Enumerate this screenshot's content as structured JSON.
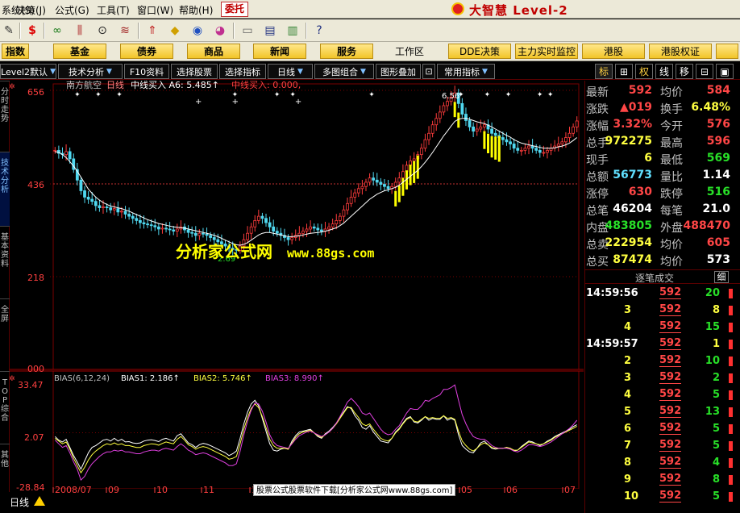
{
  "menu": {
    "items": [
      "系统(S)",
      "决策(J)",
      "公式(G)",
      "工具(T)",
      "窗口(W)",
      "帮助(H)"
    ],
    "weituo": "委托"
  },
  "brand": {
    "name": "大智慧 Level-2"
  },
  "category_buttons": [
    "指数",
    "基金",
    "债券",
    "商品",
    "新闻",
    "服务",
    "DDE决策",
    "主力实时监控",
    "港股",
    "港股权证"
  ],
  "workarea_label": "工作区",
  "func_tabs": [
    "Level2默认",
    "技术分析",
    "F10资料",
    "选择股票",
    "选择指标",
    "日线",
    "多图组合",
    "图形叠加",
    "常用指标"
  ],
  "right_tabs": [
    "标",
    "⊞",
    "权",
    "线",
    "移",
    "⊟",
    "▣"
  ],
  "left_tabs": [
    "分时走势",
    "技术分析",
    "基本资料",
    "全屏",
    "TOP综合",
    "其他"
  ],
  "chart": {
    "stock_name": "南方航空",
    "period_label": "日线",
    "indicator_line": "中线买入  A6: 5.485↑",
    "indicator_line2": "中线买入: 0.000,",
    "price_axis": [
      "656",
      "436",
      "218",
      "000"
    ],
    "hi_label": "6.56",
    "lo_label": "2.69",
    "bias_header": "BIAS(6,12,24)",
    "bias1_label": "BIAS1: 2.186↑",
    "bias2_label": "BIAS2: 5.746↑",
    "bias3_label": "BIAS3: 8.990↑",
    "bias_axis": [
      "33.47",
      "2.07",
      "-28.84"
    ],
    "date_axis": [
      "2008/07",
      "09",
      "10",
      "11",
      "12",
      "2009/02",
      "03",
      "04",
      "05",
      "06",
      "07"
    ],
    "colors": {
      "up": "#ff3c3c",
      "down": "#50d8f0",
      "ma": "#ffffff",
      "signal": "#ffff00",
      "bias1": "#ffffff",
      "bias2": "#ffff40",
      "bias3": "#e040e0",
      "grid": "#7a0000"
    }
  },
  "chart_data": {
    "type": "candlestick",
    "x_range": [
      "2008/07",
      "2009/07"
    ],
    "ylim": [
      0,
      6.56
    ],
    "close": [
      5.15,
      5.08,
      5.05,
      5.12,
      4.95,
      4.7,
      4.45,
      4.2,
      4.05,
      4.0,
      3.95,
      3.85,
      3.8,
      3.82,
      3.8,
      3.75,
      3.78,
      3.7,
      3.72,
      3.65,
      3.6,
      3.55,
      3.5,
      3.45,
      3.42,
      3.4,
      3.38,
      3.35,
      3.3,
      3.32,
      3.3,
      3.28,
      3.25,
      3.3,
      3.35,
      3.28,
      3.22,
      3.2,
      3.15,
      3.2,
      3.18,
      3.15,
      3.1,
      3.05,
      3.0,
      2.95,
      2.9,
      2.85,
      2.82,
      2.8,
      2.9,
      3.05,
      3.2,
      3.35,
      3.5,
      3.6,
      3.55,
      3.45,
      3.35,
      3.25,
      3.2,
      3.15,
      3.1,
      3.05,
      3.1,
      3.15,
      3.2,
      3.25,
      3.3,
      3.35,
      3.32,
      3.28,
      3.25,
      3.3,
      3.35,
      3.42,
      3.5,
      3.6,
      3.75,
      3.9,
      4.05,
      4.15,
      4.25,
      4.3,
      4.4,
      4.5,
      4.45,
      4.4,
      4.35,
      4.3,
      4.25,
      4.3,
      4.4,
      4.5,
      4.65,
      4.8,
      4.9,
      4.95,
      5.05,
      5.2,
      5.4,
      5.55,
      5.75,
      5.9,
      6.05,
      6.2,
      6.3,
      6.4,
      6.5,
      6.25,
      6.0,
      5.85,
      5.7,
      5.6,
      5.65,
      5.7,
      5.75,
      5.65,
      5.55,
      5.5,
      5.45,
      5.4,
      5.35,
      5.3,
      5.2,
      5.15,
      5.15,
      5.2,
      5.25,
      5.2,
      5.15,
      5.1,
      5.1,
      5.15,
      5.2,
      5.25,
      5.3,
      5.35,
      5.45,
      5.55,
      5.7,
      5.84
    ],
    "ma": [
      5.12,
      5.1,
      5.05,
      4.98,
      4.88,
      4.78,
      4.66,
      4.52,
      4.38,
      4.24,
      4.14,
      4.05,
      3.98,
      3.92,
      3.88,
      3.84,
      3.82,
      3.8,
      3.78,
      3.75,
      3.72,
      3.68,
      3.64,
      3.6,
      3.56,
      3.52,
      3.49,
      3.46,
      3.43,
      3.41,
      3.39,
      3.37,
      3.35,
      3.34,
      3.33,
      3.32,
      3.3,
      3.28,
      3.26,
      3.24,
      3.22,
      3.2,
      3.18,
      3.15,
      3.12,
      3.08,
      3.04,
      3.0,
      2.96,
      2.93,
      2.92,
      2.94,
      2.98,
      3.04,
      3.1,
      3.16,
      3.2,
      3.22,
      3.22,
      3.2,
      3.18,
      3.16,
      3.14,
      3.12,
      3.12,
      3.13,
      3.14,
      3.16,
      3.18,
      3.2,
      3.21,
      3.22,
      3.23,
      3.25,
      3.27,
      3.3,
      3.33,
      3.38,
      3.44,
      3.52,
      3.6,
      3.68,
      3.76,
      3.84,
      3.92,
      4.0,
      4.06,
      4.12,
      4.16,
      4.2,
      4.22,
      4.25,
      4.28,
      4.33,
      4.4,
      4.47,
      4.54,
      4.61,
      4.68,
      4.77,
      4.87,
      4.98,
      5.1,
      5.23,
      5.36,
      5.49,
      5.6,
      5.72,
      5.83,
      5.88,
      5.9,
      5.9,
      5.88,
      5.85,
      5.82,
      5.8,
      5.78,
      5.74,
      5.7,
      5.65,
      5.6,
      5.55,
      5.5,
      5.46,
      5.4,
      5.36,
      5.32,
      5.3,
      5.28,
      5.26,
      5.24,
      5.22,
      5.2,
      5.2,
      5.2,
      5.21,
      5.23,
      5.25,
      5.28,
      5.32,
      5.38,
      5.45
    ],
    "signals": [
      {
        "i": 92,
        "level": 0.42
      },
      {
        "i": 93,
        "level": 0.48
      },
      {
        "i": 94,
        "level": 0.55
      },
      {
        "i": 95,
        "level": 0.62
      },
      {
        "i": 96,
        "level": 0.7
      },
      {
        "i": 97,
        "level": 0.78
      },
      {
        "i": 98,
        "level": 0.86
      },
      {
        "i": 108,
        "level": 0.4
      },
      {
        "i": 109,
        "level": 0.4
      },
      {
        "i": 116,
        "level": 0.55
      },
      {
        "i": 117,
        "level": 0.65
      },
      {
        "i": 118,
        "level": 0.75
      },
      {
        "i": 119,
        "level": 0.85
      },
      {
        "i": 120,
        "level": 1.0
      }
    ],
    "bias_ylim": [
      -28.84,
      33.47
    ],
    "bias1": [
      0.0,
      -2.0,
      -3.0,
      -1.5,
      -6.0,
      -10.5,
      -14.0,
      -18.0,
      -13.5,
      -9.0,
      -6.0,
      -5.0,
      -3.5,
      -2.0,
      -1.5,
      -2.5,
      -1.0,
      -2.5,
      -1.5,
      -3.0,
      -2.8,
      -3.5,
      -3.8,
      -3.5,
      -2.5,
      -2.0,
      -1.8,
      -2.2,
      -2.8,
      -1.5,
      -1.0,
      -1.8,
      -2.5,
      0.5,
      1.5,
      -1.0,
      -3.5,
      -4.5,
      -6.0,
      -4.5,
      -3.8,
      -4.2,
      -5.0,
      -6.0,
      -7.0,
      -8.0,
      -9.0,
      -10.5,
      -9.5,
      -8.0,
      -1.0,
      7.0,
      13.5,
      18.0,
      20.0,
      17.0,
      10.0,
      3.0,
      -4.0,
      -7.5,
      -8.0,
      -7.0,
      -6.5,
      -7.0,
      -2.5,
      0.5,
      2.5,
      3.0,
      3.5,
      4.0,
      2.0,
      0.0,
      -1.0,
      1.5,
      3.0,
      5.0,
      7.5,
      10.5,
      13.5,
      16.5,
      15.5,
      11.5,
      9.0,
      5.0,
      4.0,
      6.0,
      2.5,
      0.0,
      -2.5,
      -3.0,
      -3.5,
      -1.0,
      2.5,
      4.5,
      7.5,
      10.0,
      11.0,
      8.0,
      7.5,
      9.0,
      11.0,
      9.0,
      10.0,
      9.5,
      9.5,
      11.5,
      9.0,
      10.0,
      9.0,
      1.0,
      -5.0,
      -7.0,
      -8.5,
      -9.0,
      -6.5,
      -3.5,
      -2.5,
      -4.5,
      -6.5,
      -7.0,
      -6.5,
      -6.5,
      -6.0,
      -6.5,
      -8.0,
      -7.5,
      -5.5,
      -4.0,
      -2.5,
      -3.0,
      -4.0,
      -5.0,
      -4.0,
      -2.5,
      -1.5,
      0.0,
      1.0,
      2.0,
      3.0,
      4.0,
      5.5,
      6.5
    ],
    "bias2": [
      -1.0,
      -2.5,
      -4.0,
      -3.0,
      -7.0,
      -12.0,
      -16.0,
      -20.0,
      -17.0,
      -13.0,
      -10.0,
      -8.0,
      -6.5,
      -5.0,
      -4.0,
      -4.5,
      -3.5,
      -4.5,
      -4.0,
      -5.0,
      -5.0,
      -5.5,
      -6.0,
      -6.0,
      -5.0,
      -4.5,
      -4.0,
      -4.2,
      -4.8,
      -3.8,
      -3.0,
      -3.5,
      -4.0,
      -1.5,
      0.0,
      -2.0,
      -4.5,
      -5.5,
      -7.0,
      -6.0,
      -5.5,
      -6.0,
      -7.0,
      -8.0,
      -9.0,
      -10.0,
      -11.0,
      -12.5,
      -12.0,
      -11.0,
      -4.0,
      4.0,
      10.5,
      15.5,
      18.0,
      16.0,
      11.0,
      5.0,
      -1.5,
      -5.0,
      -6.5,
      -6.5,
      -6.5,
      -7.0,
      -3.5,
      -0.5,
      1.5,
      2.5,
      3.0,
      3.5,
      2.0,
      0.5,
      -0.5,
      1.0,
      2.5,
      4.5,
      7.0,
      10.0,
      13.0,
      16.0,
      16.0,
      13.0,
      10.5,
      7.0,
      6.0,
      7.0,
      4.0,
      1.5,
      -1.0,
      -2.0,
      -2.5,
      -1.0,
      2.0,
      4.0,
      7.0,
      9.5,
      10.5,
      8.5,
      8.0,
      9.5,
      11.0,
      10.0,
      10.5,
      10.0,
      10.0,
      11.5,
      10.0,
      10.5,
      9.5,
      3.0,
      -2.5,
      -5.0,
      -7.0,
      -8.0,
      -6.5,
      -4.5,
      -3.5,
      -4.5,
      -6.0,
      -6.5,
      -6.5,
      -6.5,
      -6.0,
      -6.5,
      -7.5,
      -7.5,
      -6.0,
      -4.5,
      -3.0,
      -3.5,
      -4.0,
      -4.5,
      -4.0,
      -3.0,
      -2.0,
      -0.5,
      0.5,
      1.5,
      2.5,
      3.5,
      4.5,
      5.7
    ],
    "bias3": [
      -2.0,
      -4.0,
      -6.0,
      -5.0,
      -9.0,
      -14.0,
      -18.0,
      -24.0,
      -22.0,
      -18.0,
      -15.0,
      -13.0,
      -11.0,
      -9.5,
      -8.5,
      -8.5,
      -7.5,
      -8.0,
      -7.5,
      -8.5,
      -8.5,
      -9.0,
      -9.5,
      -9.5,
      -8.5,
      -8.0,
      -7.5,
      -7.5,
      -8.0,
      -7.0,
      -6.5,
      -7.0,
      -7.5,
      -5.5,
      -4.0,
      -5.5,
      -7.5,
      -8.5,
      -10.0,
      -9.5,
      -9.0,
      -9.5,
      -10.5,
      -11.5,
      -12.5,
      -13.5,
      -14.5,
      -16.0,
      -16.0,
      -15.0,
      -8.0,
      1.0,
      8.5,
      14.5,
      18.5,
      18.0,
      14.0,
      8.0,
      1.0,
      -3.0,
      -5.0,
      -5.5,
      -6.0,
      -6.5,
      -4.0,
      -1.5,
      0.5,
      1.5,
      2.5,
      3.0,
      2.0,
      1.0,
      0.0,
      1.0,
      2.5,
      4.5,
      7.5,
      11.0,
      15.0,
      19.0,
      21.0,
      19.0,
      16.5,
      13.0,
      12.0,
      13.0,
      10.0,
      7.0,
      4.0,
      2.0,
      1.0,
      1.5,
      4.0,
      6.0,
      9.5,
      13.0,
      15.5,
      15.0,
      15.0,
      17.0,
      20.0,
      19.5,
      21.0,
      22.0,
      23.0,
      26.0,
      26.0,
      27.0,
      28.5,
      20.0,
      12.0,
      7.0,
      3.0,
      0.0,
      -1.0,
      -1.5,
      -1.5,
      -3.0,
      -5.0,
      -6.0,
      -6.5,
      -6.5,
      -6.5,
      -7.0,
      -8.0,
      -8.5,
      -7.5,
      -6.0,
      -4.5,
      -4.5,
      -5.0,
      -5.5,
      -5.0,
      -4.0,
      -3.0,
      -1.5,
      0.0,
      1.5,
      3.0,
      4.5,
      6.5,
      9.0
    ]
  },
  "quote": {
    "rows": [
      {
        "l1": "最新",
        "v1": "592",
        "c1": "red",
        "l2": "均价",
        "v2": "584",
        "c2": "red"
      },
      {
        "l1": "涨跌",
        "v1": "▲019",
        "c1": "red",
        "l2": "换手",
        "v2": "6.48%",
        "c2": "yel"
      },
      {
        "l1": "涨幅",
        "v1": "3.32%",
        "c1": "red",
        "l2": "今开",
        "v2": "576",
        "c2": "red"
      },
      {
        "l1": "总手",
        "v1": "972275",
        "c1": "yel",
        "l2": "最高",
        "v2": "596",
        "c2": "red"
      },
      {
        "l1": "现手",
        "v1": "6",
        "c1": "yel",
        "l2": "最低",
        "v2": "569",
        "c2": "grn"
      },
      {
        "l1": "总额",
        "v1": "56773",
        "c1": "cyn",
        "l2": "量比",
        "v2": "1.14",
        "c2": "wht"
      },
      {
        "l1": "涨停",
        "v1": "630",
        "c1": "red",
        "l2": "跌停",
        "v2": "516",
        "c2": "grn"
      },
      {
        "l1": "总笔",
        "v1": "46204",
        "c1": "wht",
        "l2": "每笔",
        "v2": "21.0",
        "c2": "wht"
      },
      {
        "l1": "内盘",
        "v1": "483805",
        "c1": "grn",
        "l2": "外盘",
        "v2": "488470",
        "c2": "red"
      },
      {
        "l1": "总卖",
        "v1": "222954",
        "c1": "yel",
        "l2": "均价",
        "v2": "605",
        "c2": "red"
      },
      {
        "l1": "总买",
        "v1": "87474",
        "c1": "yel",
        "l2": "均价",
        "v2": "573",
        "c2": "wht"
      }
    ]
  },
  "ticks": {
    "title": "逐笔成交",
    "detail": "细",
    "rows": [
      {
        "time": "14:59:56",
        "price": "592",
        "vol": "20",
        "vc": "grn"
      },
      {
        "time": "3",
        "price": "592",
        "vol": "8",
        "vc": "yel"
      },
      {
        "time": "4",
        "price": "592",
        "vol": "15",
        "vc": "grn"
      },
      {
        "time": "14:59:57",
        "price": "592",
        "vol": "1",
        "vc": "yel"
      },
      {
        "time": "2",
        "price": "592",
        "vol": "10",
        "vc": "grn"
      },
      {
        "time": "3",
        "price": "592",
        "vol": "2",
        "vc": "grn"
      },
      {
        "time": "4",
        "price": "592",
        "vol": "5",
        "vc": "grn"
      },
      {
        "time": "5",
        "price": "592",
        "vol": "13",
        "vc": "grn"
      },
      {
        "time": "6",
        "price": "592",
        "vol": "5",
        "vc": "grn"
      },
      {
        "time": "7",
        "price": "592",
        "vol": "5",
        "vc": "grn"
      },
      {
        "time": "8",
        "price": "592",
        "vol": "4",
        "vc": "grn"
      },
      {
        "time": "9",
        "price": "592",
        "vol": "8",
        "vc": "grn"
      },
      {
        "time": "10",
        "price": "592",
        "vol": "5",
        "vc": "grn"
      }
    ]
  },
  "status": {
    "period": "日线"
  },
  "watermark": {
    "text": "分析家公式网",
    "url": "www.88gs.com"
  },
  "footer_banner": "股票公式股票软件下载[分析家公式网www.88gs.com]"
}
